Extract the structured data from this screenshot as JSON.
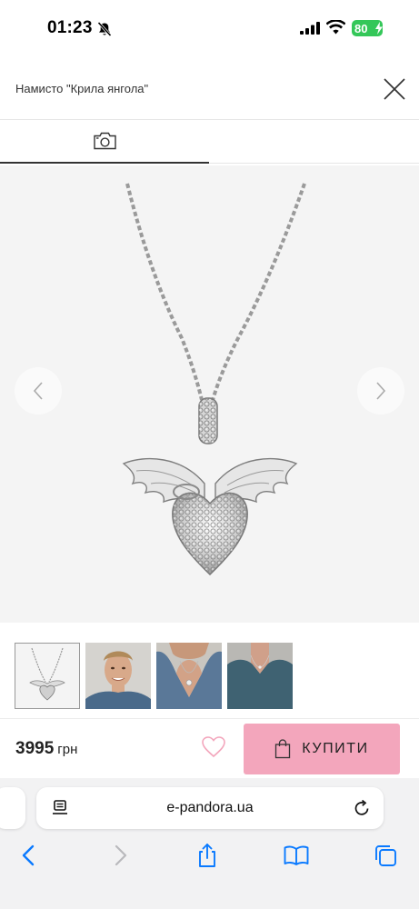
{
  "status_bar": {
    "time": "01:23",
    "battery": "80"
  },
  "modal": {
    "title": "Намисто \"Крила янгола\""
  },
  "product": {
    "price": "3995",
    "currency": "грн",
    "buy_label": "КУПИТИ"
  },
  "browser": {
    "url": "e-pandora.ua"
  },
  "colors": {
    "buy_button": "#f3a6bc",
    "wishlist": "#f3a6bc",
    "safari_blue": "#0a7aff",
    "battery": "#34c759"
  },
  "icons": [
    "bell-off-icon",
    "signal-icon",
    "wifi-icon",
    "battery-icon",
    "close-icon",
    "camera-icon",
    "chevron-left-icon",
    "chevron-right-icon",
    "heart-icon",
    "shopping-bag-icon",
    "reader-icon",
    "reload-icon",
    "back-icon",
    "forward-icon",
    "share-icon",
    "bookmarks-icon",
    "tabs-icon"
  ]
}
